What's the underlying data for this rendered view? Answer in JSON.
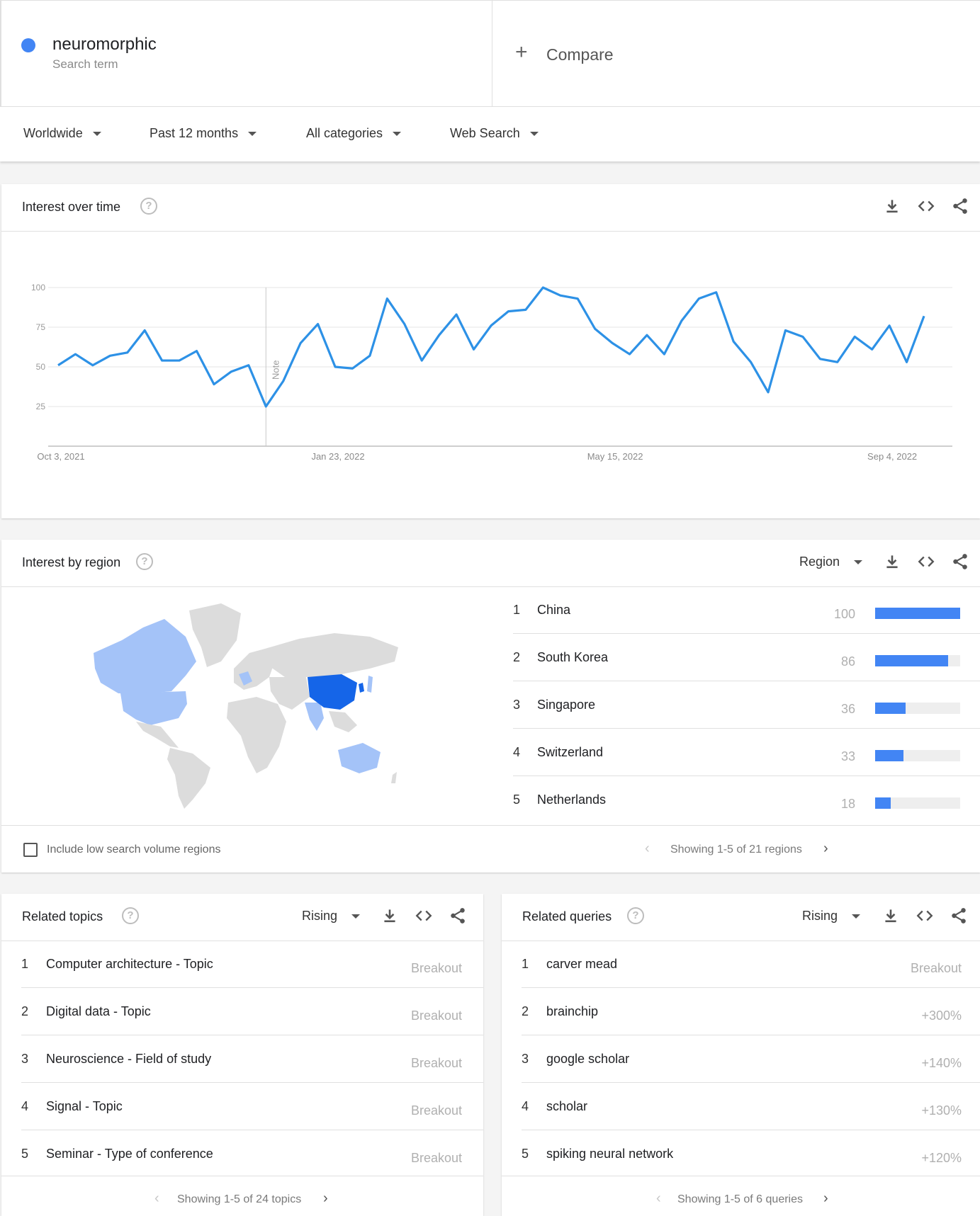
{
  "search": {
    "term": "neuromorphic",
    "term_type": "Search term",
    "term_color": "#4285f4",
    "compare_label": "Compare"
  },
  "filters": {
    "location": "Worldwide",
    "time_range": "Past 12 months",
    "category": "All categories",
    "property": "Web Search"
  },
  "interest_over_time": {
    "title": "Interest over time",
    "note_label": "Note",
    "chart_data": {
      "type": "line",
      "line_color": "#2d91e6",
      "ylim": [
        0,
        100
      ],
      "yticks": [
        25,
        50,
        75,
        100
      ],
      "x_tick_labels": [
        "Oct 3, 2021",
        "Jan 23, 2022",
        "May 15, 2022",
        "Sep 4, 2022"
      ],
      "x_tick_index": [
        0,
        16,
        32,
        48
      ],
      "note_index": 12,
      "partial_from_index": 51,
      "values": [
        51,
        58,
        51,
        57,
        59,
        73,
        54,
        54,
        60,
        39,
        47,
        51,
        25,
        41,
        65,
        77,
        50,
        49,
        57,
        93,
        77,
        54,
        70,
        83,
        61,
        76,
        85,
        86,
        100,
        95,
        93,
        74,
        65,
        58,
        70,
        58,
        79,
        93,
        97,
        66,
        53,
        34,
        73,
        69,
        55,
        53,
        69,
        61,
        76,
        53,
        82
      ]
    }
  },
  "interest_by_region": {
    "title": "Interest by region",
    "resolution": "Region",
    "colors": {
      "strong": "#1565e8",
      "light": "#a4c3f8",
      "none": "#dcdcdc"
    },
    "regions": [
      {
        "rank": "1",
        "name": "China",
        "value": 100
      },
      {
        "rank": "2",
        "name": "South Korea",
        "value": 86
      },
      {
        "rank": "3",
        "name": "Singapore",
        "value": 36
      },
      {
        "rank": "4",
        "name": "Switzerland",
        "value": 33
      },
      {
        "rank": "5",
        "name": "Netherlands",
        "value": 18
      }
    ],
    "low_volume_label": "Include low search volume regions",
    "pager": "Showing 1-5 of 21 regions"
  },
  "related_topics": {
    "title": "Related topics",
    "mode": "Rising",
    "items": [
      {
        "rank": "1",
        "name": "Computer architecture - Topic",
        "value": "Breakout"
      },
      {
        "rank": "2",
        "name": "Digital data - Topic",
        "value": "Breakout"
      },
      {
        "rank": "3",
        "name": "Neuroscience - Field of study",
        "value": "Breakout"
      },
      {
        "rank": "4",
        "name": "Signal - Topic",
        "value": "Breakout"
      },
      {
        "rank": "5",
        "name": "Seminar - Type of conference",
        "value": "Breakout"
      }
    ],
    "pager": "Showing 1-5 of 24 topics"
  },
  "related_queries": {
    "title": "Related queries",
    "mode": "Rising",
    "items": [
      {
        "rank": "1",
        "name": "carver mead",
        "value": "Breakout"
      },
      {
        "rank": "2",
        "name": "brainchip",
        "value": "+300%"
      },
      {
        "rank": "3",
        "name": "google scholar",
        "value": "+140%"
      },
      {
        "rank": "4",
        "name": "scholar",
        "value": "+130%"
      },
      {
        "rank": "5",
        "name": "spiking neural network",
        "value": "+120%"
      }
    ],
    "pager": "Showing 1-5 of 6 queries"
  }
}
